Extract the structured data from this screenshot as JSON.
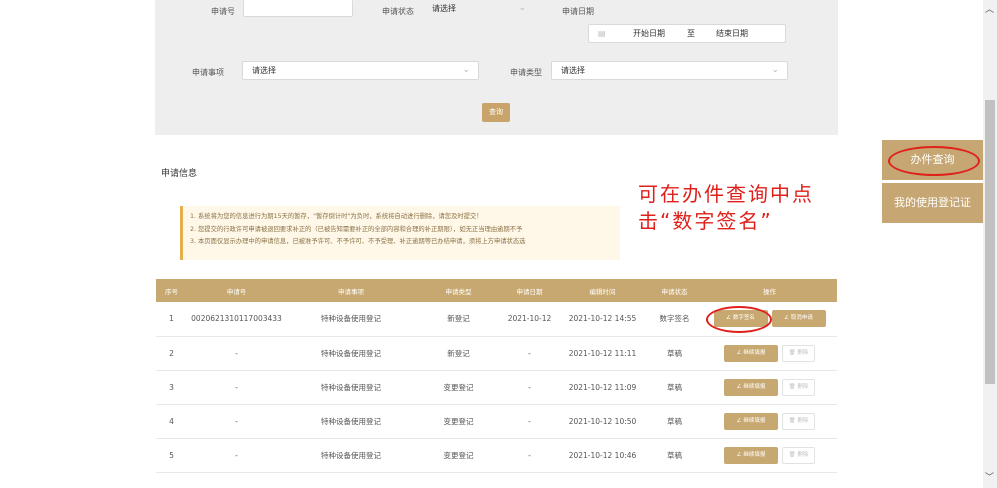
{
  "form": {
    "apply_no": {
      "label": "申请号",
      "value": ""
    },
    "apply_status": {
      "label": "申请状态",
      "value": "请选择"
    },
    "apply_date": {
      "label": "申请日期",
      "start": "开始日期",
      "to": "至",
      "end": "结束日期"
    },
    "apply_item": {
      "label": "申请事项",
      "value": "请选择"
    },
    "apply_type": {
      "label": "申请类型",
      "value": "请选择"
    },
    "query_label": "查询"
  },
  "section_title": "申请信息",
  "notices": [
    "1. 系统将为您的信息进行为期15天的暂存，\"暂存倒计时\"为负时，系统将自动进行删除，请您及时提交！",
    "2. 您提交的行政许可申请被退回要求补正的（已被告知需要补正的全部内容和合理的补正期限），如无正当理由逾期不予",
    "3. 本页面仅显示办理中的申请信息，已被准予许可、不予许可、不予受理、补正逾期等已办结申请，须将上方申请状态选"
  ],
  "callout_text": "可在办件查询中点击“数字签名”",
  "side_buttons": {
    "query": "办件查询",
    "registry": "我的使用登记证"
  },
  "table": {
    "headers": [
      "序号",
      "申请号",
      "申请事项",
      "申请类型",
      "申请日期",
      "编辑时间",
      "申请状态",
      "操作"
    ],
    "rows": [
      {
        "no": "1",
        "apply_no": "0020621310117003433",
        "item": "特种设备使用登记",
        "type": "新登记",
        "date": "2021-10-12",
        "edit_time": "2021-10-12 14:55",
        "status": "数字签名",
        "a1": "∠ 数字签名",
        "a2": "∠ 取消申请"
      },
      {
        "no": "2",
        "apply_no": "-",
        "item": "特种设备使用登记",
        "type": "新登记",
        "date": "-",
        "edit_time": "2021-10-12 11:11",
        "status": "草稿",
        "a1": "∠ 继续填报",
        "a2": "🗑 删除"
      },
      {
        "no": "3",
        "apply_no": "-",
        "item": "特种设备使用登记",
        "type": "变更登记",
        "date": "-",
        "edit_time": "2021-10-12 11:09",
        "status": "草稿",
        "a1": "∠ 继续填报",
        "a2": "🗑 删除"
      },
      {
        "no": "4",
        "apply_no": "-",
        "item": "特种设备使用登记",
        "type": "变更登记",
        "date": "-",
        "edit_time": "2021-10-12 10:50",
        "status": "草稿",
        "a1": "∠ 继续填报",
        "a2": "🗑 删除"
      },
      {
        "no": "5",
        "apply_no": "-",
        "item": "特种设备使用登记",
        "type": "变更登记",
        "date": "-",
        "edit_time": "2021-10-12 10:46",
        "status": "草稿",
        "a1": "∠ 继续填报",
        "a2": "🗑 删除"
      }
    ]
  },
  "colors": {
    "accent_gold": "#c8a871",
    "annotation_red": "#e0201b"
  }
}
